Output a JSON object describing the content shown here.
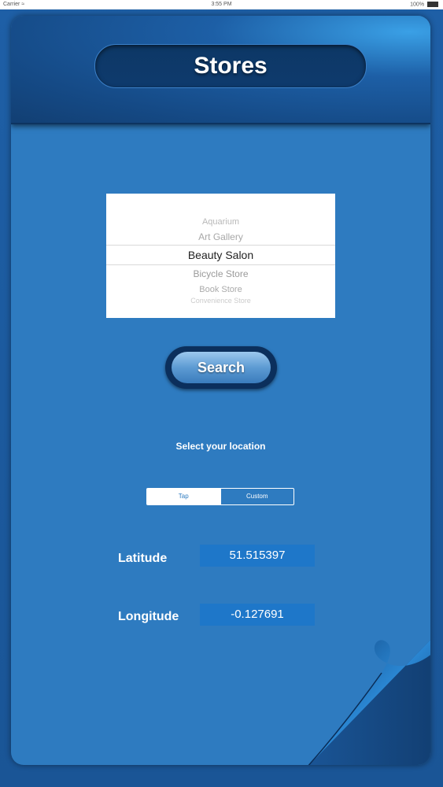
{
  "status_bar": {
    "carrier": "Carrier ≈",
    "time": "3:55 PM",
    "battery": "100%"
  },
  "header": {
    "title": "Stores"
  },
  "picker": {
    "items": [
      "Aquarium",
      "Art Gallery",
      "Beauty Salon",
      "Bicycle Store",
      "Book Store",
      "Convenience Store"
    ],
    "selected": "Beauty Salon"
  },
  "search": {
    "label": "Search"
  },
  "location": {
    "prompt": "Select your location",
    "segments": [
      "Tap",
      "Custom"
    ],
    "selected_segment": "Tap"
  },
  "coords": {
    "latitude_label": "Latitude",
    "latitude_value": "51.515397",
    "longitude_label": "Longitude",
    "longitude_value": "-0.127691"
  },
  "colors": {
    "panel": "#2e7bc0",
    "header_dark": "#123f73",
    "field_bg": "#1e77c9"
  }
}
